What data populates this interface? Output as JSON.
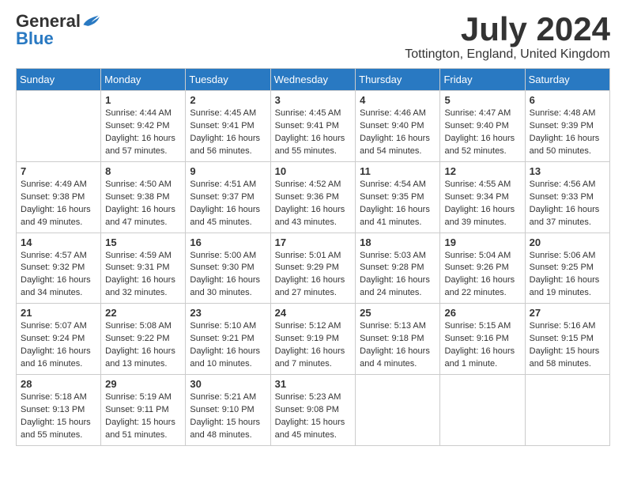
{
  "header": {
    "logo_general": "General",
    "logo_blue": "Blue",
    "month_title": "July 2024",
    "location": "Tottington, England, United Kingdom"
  },
  "calendar": {
    "days_of_week": [
      "Sunday",
      "Monday",
      "Tuesday",
      "Wednesday",
      "Thursday",
      "Friday",
      "Saturday"
    ],
    "weeks": [
      [
        {
          "day": "",
          "info": ""
        },
        {
          "day": "1",
          "info": "Sunrise: 4:44 AM\nSunset: 9:42 PM\nDaylight: 16 hours\nand 57 minutes."
        },
        {
          "day": "2",
          "info": "Sunrise: 4:45 AM\nSunset: 9:41 PM\nDaylight: 16 hours\nand 56 minutes."
        },
        {
          "day": "3",
          "info": "Sunrise: 4:45 AM\nSunset: 9:41 PM\nDaylight: 16 hours\nand 55 minutes."
        },
        {
          "day": "4",
          "info": "Sunrise: 4:46 AM\nSunset: 9:40 PM\nDaylight: 16 hours\nand 54 minutes."
        },
        {
          "day": "5",
          "info": "Sunrise: 4:47 AM\nSunset: 9:40 PM\nDaylight: 16 hours\nand 52 minutes."
        },
        {
          "day": "6",
          "info": "Sunrise: 4:48 AM\nSunset: 9:39 PM\nDaylight: 16 hours\nand 50 minutes."
        }
      ],
      [
        {
          "day": "7",
          "info": "Sunrise: 4:49 AM\nSunset: 9:38 PM\nDaylight: 16 hours\nand 49 minutes."
        },
        {
          "day": "8",
          "info": "Sunrise: 4:50 AM\nSunset: 9:38 PM\nDaylight: 16 hours\nand 47 minutes."
        },
        {
          "day": "9",
          "info": "Sunrise: 4:51 AM\nSunset: 9:37 PM\nDaylight: 16 hours\nand 45 minutes."
        },
        {
          "day": "10",
          "info": "Sunrise: 4:52 AM\nSunset: 9:36 PM\nDaylight: 16 hours\nand 43 minutes."
        },
        {
          "day": "11",
          "info": "Sunrise: 4:54 AM\nSunset: 9:35 PM\nDaylight: 16 hours\nand 41 minutes."
        },
        {
          "day": "12",
          "info": "Sunrise: 4:55 AM\nSunset: 9:34 PM\nDaylight: 16 hours\nand 39 minutes."
        },
        {
          "day": "13",
          "info": "Sunrise: 4:56 AM\nSunset: 9:33 PM\nDaylight: 16 hours\nand 37 minutes."
        }
      ],
      [
        {
          "day": "14",
          "info": "Sunrise: 4:57 AM\nSunset: 9:32 PM\nDaylight: 16 hours\nand 34 minutes."
        },
        {
          "day": "15",
          "info": "Sunrise: 4:59 AM\nSunset: 9:31 PM\nDaylight: 16 hours\nand 32 minutes."
        },
        {
          "day": "16",
          "info": "Sunrise: 5:00 AM\nSunset: 9:30 PM\nDaylight: 16 hours\nand 30 minutes."
        },
        {
          "day": "17",
          "info": "Sunrise: 5:01 AM\nSunset: 9:29 PM\nDaylight: 16 hours\nand 27 minutes."
        },
        {
          "day": "18",
          "info": "Sunrise: 5:03 AM\nSunset: 9:28 PM\nDaylight: 16 hours\nand 24 minutes."
        },
        {
          "day": "19",
          "info": "Sunrise: 5:04 AM\nSunset: 9:26 PM\nDaylight: 16 hours\nand 22 minutes."
        },
        {
          "day": "20",
          "info": "Sunrise: 5:06 AM\nSunset: 9:25 PM\nDaylight: 16 hours\nand 19 minutes."
        }
      ],
      [
        {
          "day": "21",
          "info": "Sunrise: 5:07 AM\nSunset: 9:24 PM\nDaylight: 16 hours\nand 16 minutes."
        },
        {
          "day": "22",
          "info": "Sunrise: 5:08 AM\nSunset: 9:22 PM\nDaylight: 16 hours\nand 13 minutes."
        },
        {
          "day": "23",
          "info": "Sunrise: 5:10 AM\nSunset: 9:21 PM\nDaylight: 16 hours\nand 10 minutes."
        },
        {
          "day": "24",
          "info": "Sunrise: 5:12 AM\nSunset: 9:19 PM\nDaylight: 16 hours\nand 7 minutes."
        },
        {
          "day": "25",
          "info": "Sunrise: 5:13 AM\nSunset: 9:18 PM\nDaylight: 16 hours\nand 4 minutes."
        },
        {
          "day": "26",
          "info": "Sunrise: 5:15 AM\nSunset: 9:16 PM\nDaylight: 16 hours\nand 1 minute."
        },
        {
          "day": "27",
          "info": "Sunrise: 5:16 AM\nSunset: 9:15 PM\nDaylight: 15 hours\nand 58 minutes."
        }
      ],
      [
        {
          "day": "28",
          "info": "Sunrise: 5:18 AM\nSunset: 9:13 PM\nDaylight: 15 hours\nand 55 minutes."
        },
        {
          "day": "29",
          "info": "Sunrise: 5:19 AM\nSunset: 9:11 PM\nDaylight: 15 hours\nand 51 minutes."
        },
        {
          "day": "30",
          "info": "Sunrise: 5:21 AM\nSunset: 9:10 PM\nDaylight: 15 hours\nand 48 minutes."
        },
        {
          "day": "31",
          "info": "Sunrise: 5:23 AM\nSunset: 9:08 PM\nDaylight: 15 hours\nand 45 minutes."
        },
        {
          "day": "",
          "info": ""
        },
        {
          "day": "",
          "info": ""
        },
        {
          "day": "",
          "info": ""
        }
      ]
    ]
  }
}
